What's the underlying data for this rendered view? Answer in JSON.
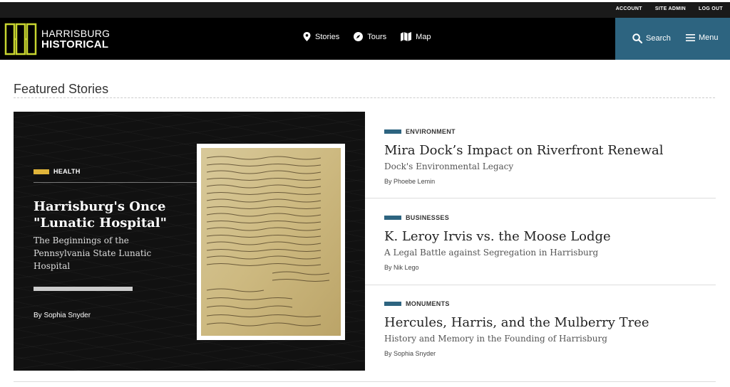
{
  "topbar": {
    "links": [
      "ACCOUNT",
      "SITE ADMIN",
      "LOG OUT"
    ]
  },
  "header": {
    "logo_line1": "HARRISBURG",
    "logo_line2": "HISTORICAL",
    "logo_color": "#c8d530",
    "nav": [
      {
        "label": "Stories",
        "icon": "map-pin-icon"
      },
      {
        "label": "Tours",
        "icon": "compass-icon"
      },
      {
        "label": "Map",
        "icon": "map-icon"
      }
    ],
    "search_label": "Search",
    "menu_label": "Menu",
    "accent_color": "#2d6480"
  },
  "main": {
    "section_title": "Featured Stories",
    "featured": {
      "category": "HEALTH",
      "category_color": "#e0b43a",
      "title": "Harrisburg's Once \"Lunatic Hospital\"",
      "subtitle": "The Beginnings of the Pennsylvania State Lunatic Hospital",
      "by_prefix": "By",
      "author": "Sophia Snyder"
    },
    "stories": [
      {
        "category": "ENVIRONMENT",
        "title": "Mira Dock’s Impact on Riverfront Renewal",
        "subtitle": "Dock's Environmental Legacy",
        "by_prefix": "By",
        "author": "Phoebe Lemin"
      },
      {
        "category": "BUSINESSES",
        "title": "K. Leroy Irvis vs. the Moose Lodge",
        "subtitle": "A Legal Battle against Segregation in Harrisburg",
        "by_prefix": "By",
        "author": "Nik Lego"
      },
      {
        "category": "MONUMENTS",
        "title": "Hercules, Harris, and the Mulberry Tree",
        "subtitle": "History and Memory in the Founding of Harrisburg",
        "by_prefix": "By",
        "author": "Sophia Snyder"
      }
    ]
  }
}
